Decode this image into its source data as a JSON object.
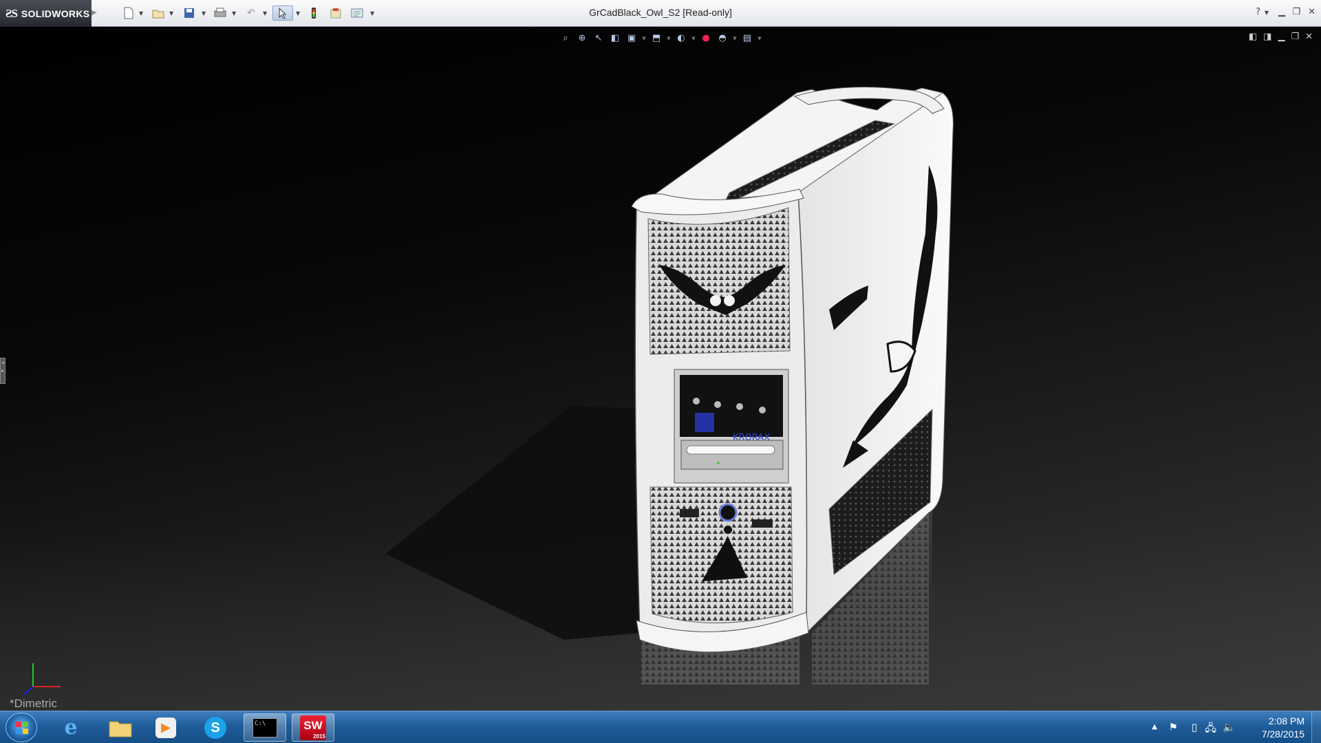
{
  "app": {
    "brand": "SOLIDWORKS",
    "title": "GrCadBlack_Owl_S2 [Read-only]"
  },
  "toolbar": {
    "icons": [
      "new-document-icon",
      "open-icon",
      "save-icon",
      "print-icon",
      "undo-icon",
      "select-icon",
      "rebuild-icon",
      "file-properties-icon",
      "options-icon"
    ]
  },
  "view_toolbar": {
    "icons": [
      "zoom-to-fit-icon",
      "zoom-to-area-icon",
      "previous-view-icon",
      "section-view-icon",
      "view-orientation-icon",
      "display-style-icon",
      "hide-show-items-icon",
      "edit-appearance-icon",
      "apply-scene-icon",
      "view-settings-icon"
    ]
  },
  "viewport": {
    "view_label": "*Dimetric",
    "model": "white computer tower case with owl graphics"
  },
  "taskbar": {
    "items": [
      {
        "name": "internet-explorer",
        "label": "e"
      },
      {
        "name": "file-explorer",
        "label": ""
      },
      {
        "name": "media-player",
        "label": "▶"
      },
      {
        "name": "skype",
        "label": "S"
      },
      {
        "name": "command-prompt",
        "label": "C:\\"
      },
      {
        "name": "solidworks-2015",
        "label": "SW",
        "badge": "2015",
        "active": true
      }
    ],
    "clock": {
      "time": "2:08 PM",
      "date": "7/28/2015"
    }
  },
  "colors": {
    "viewport_bg": "#000000",
    "taskbar": "#1f5d9a",
    "case": "#f2f2f2",
    "accent_blue": "#3355dd"
  }
}
